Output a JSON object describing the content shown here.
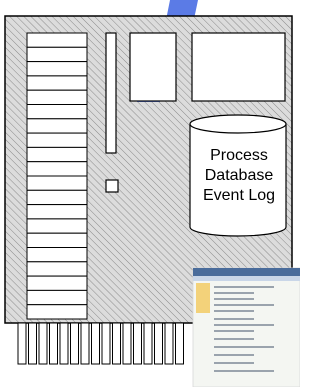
{
  "database": {
    "label_lines": [
      "Process",
      "Database",
      "Event Log"
    ]
  },
  "colors": {
    "board_fill": "#d4d4d4",
    "hatch": "#8a8a8a",
    "accent_swoosh": "#5b7be6",
    "outline": "#000000",
    "panel_fill": "#ffffff",
    "connector_fill": "#ffffff"
  },
  "icons": {
    "memory-slots": "stacked-rectangles",
    "database": "cylinder",
    "connector-pins": "vertical-bars",
    "screenshot-thumbnail": "software-window"
  }
}
